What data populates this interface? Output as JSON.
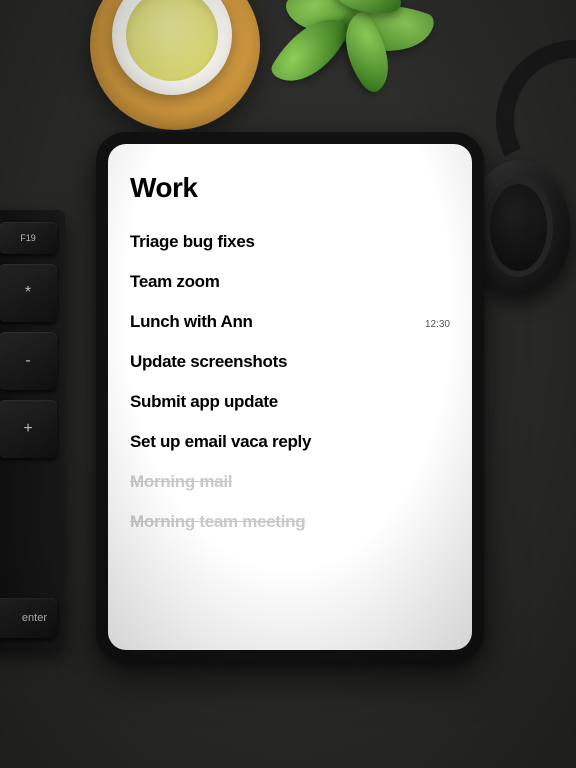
{
  "list_title": "Work",
  "tasks": [
    {
      "text": "Triage bug fixes",
      "time": "",
      "done": false
    },
    {
      "text": "Team zoom",
      "time": "",
      "done": false
    },
    {
      "text": "Lunch with Ann",
      "time": "12:30",
      "done": false
    },
    {
      "text": "Update screenshots",
      "time": "",
      "done": false
    },
    {
      "text": "Submit app update",
      "time": "",
      "done": false
    },
    {
      "text": "Set up email vaca reply",
      "time": "",
      "done": false
    },
    {
      "text": "Morning mail",
      "time": "",
      "done": true
    },
    {
      "text": "Morning team meeting",
      "time": "",
      "done": true
    }
  ],
  "keyboard_keys": {
    "f19": "F19",
    "asterisk": "*",
    "minus": "-",
    "plus": "+",
    "enter": "enter"
  }
}
